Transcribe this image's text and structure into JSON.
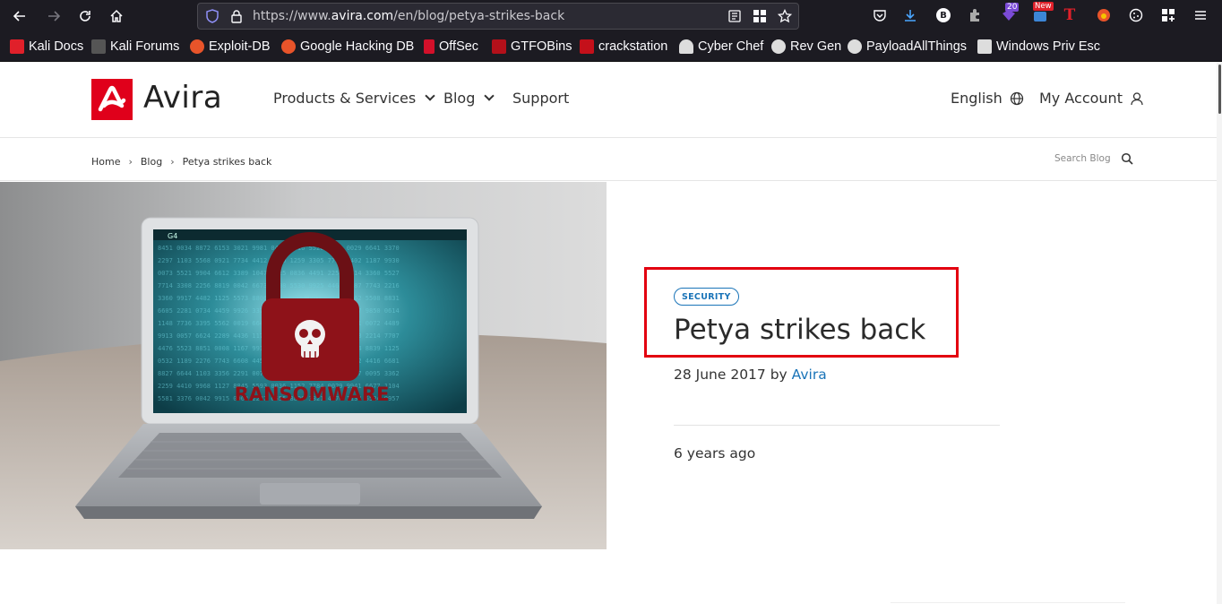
{
  "browser": {
    "url_prefix": "https://www.",
    "url_host": "avira.com",
    "url_path": "/en/blog/petya-strikes-back",
    "ext_badge_count": "20",
    "ext_badge_new": "New",
    "ext_b_letter": "B",
    "ext_t_letter": "T"
  },
  "bookmarks": [
    {
      "label": "Kali Docs",
      "color": "#e0202a"
    },
    {
      "label": "Kali Forums",
      "color": "#222222"
    },
    {
      "label": "Exploit-DB",
      "color": "#e8542a"
    },
    {
      "label": "Google Hacking DB",
      "color": "#e8542a"
    },
    {
      "label": "OffSec",
      "color": "#d3102a"
    },
    {
      "label": "GTFOBins",
      "color": "#b3101a"
    },
    {
      "label": "crackstation",
      "color": "#c4101a"
    },
    {
      "label": "Cyber Chef",
      "color": "#dddddd"
    },
    {
      "label": "Rev Gen",
      "color": "#dddddd"
    },
    {
      "label": "PayloadAllThings",
      "color": "#dddddd"
    },
    {
      "label": "Windows Priv Esc",
      "color": "#dddddd"
    }
  ],
  "site": {
    "brand": "Avira",
    "brand_color": "#e0001b",
    "nav": {
      "products": "Products & Services",
      "blog": "Blog",
      "support": "Support",
      "language": "English",
      "account": "My Account"
    }
  },
  "breadcrumb": {
    "home": "Home",
    "blog": "Blog",
    "current": "Petya strikes back",
    "search_placeholder": "Search Blog"
  },
  "post": {
    "tag": "SECURITY",
    "title": "Petya strikes back",
    "date": "28 June 2017",
    "by": "by",
    "author": "Avira",
    "ago": "6 years ago",
    "image_text": "RANSOMWARE",
    "image_status": "G4"
  }
}
